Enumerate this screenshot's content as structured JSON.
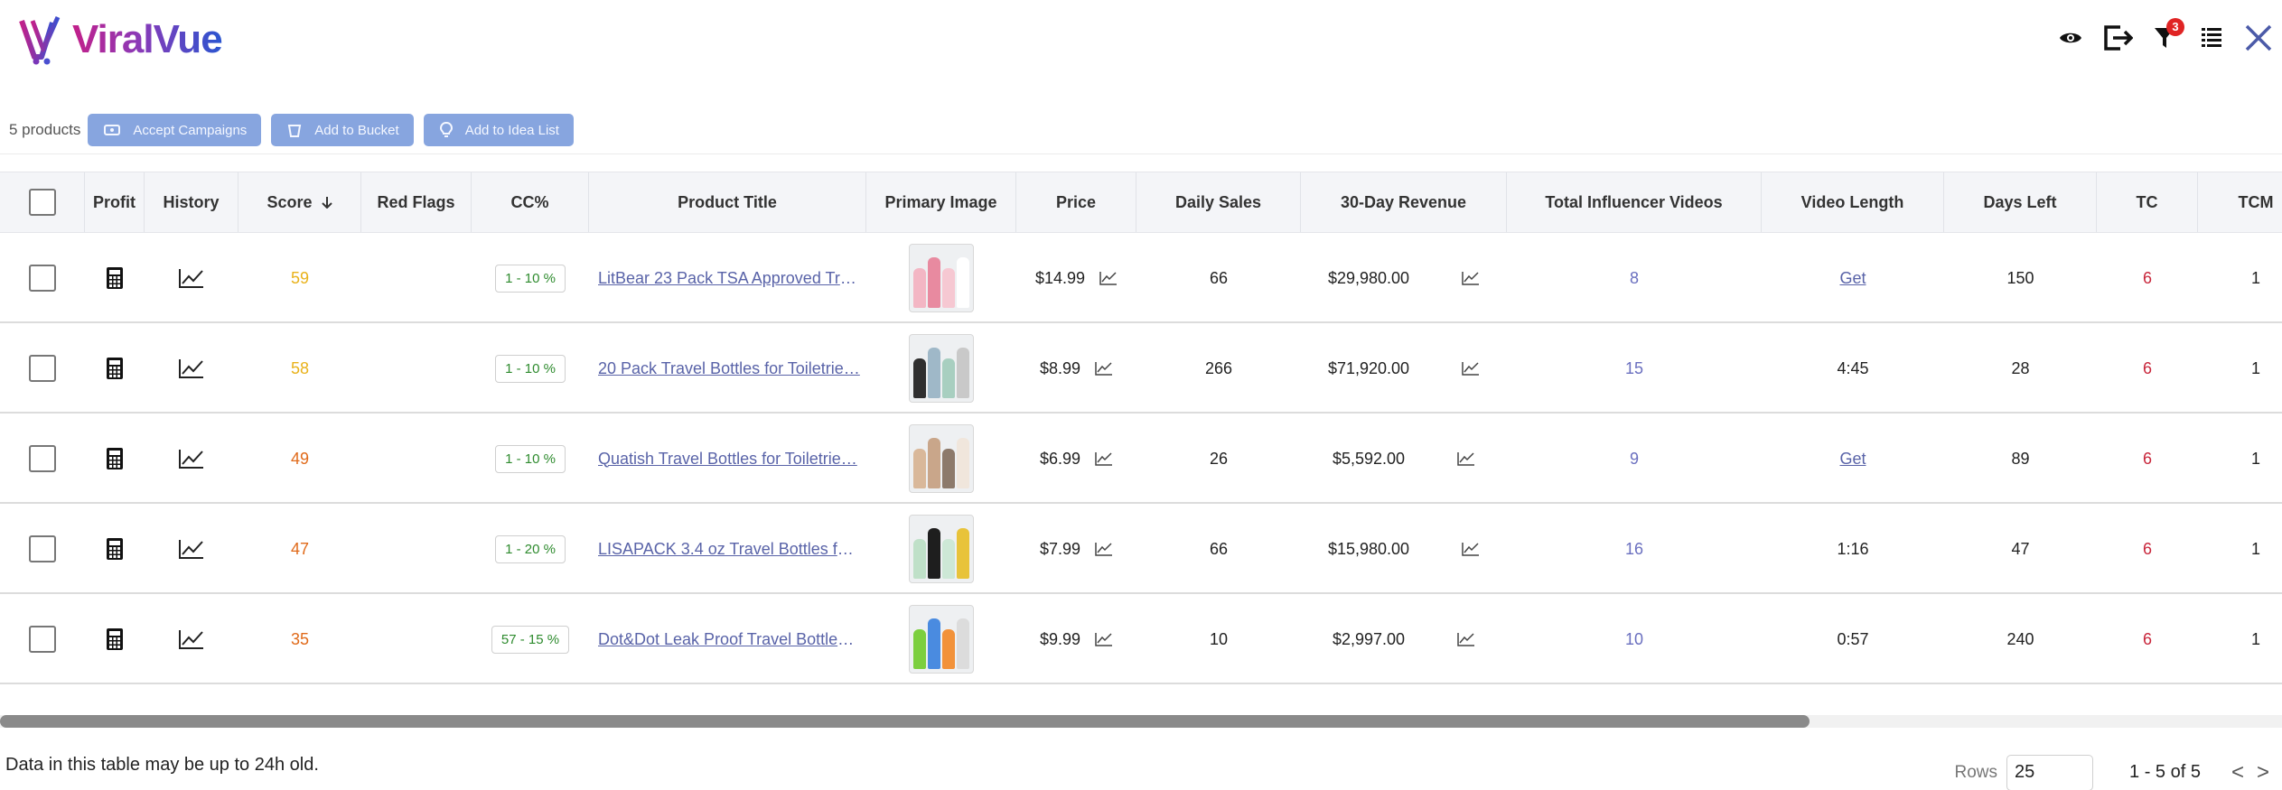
{
  "app": {
    "brand": "ViralVue"
  },
  "header": {
    "icons": [
      "eye-icon",
      "export-icon",
      "filter-icon",
      "columns-icon",
      "close-icon"
    ],
    "filter_badge": "3"
  },
  "toolbar": {
    "product_count": "5 products",
    "accept_campaigns": "Accept Campaigns",
    "add_to_bucket": "Add to Bucket",
    "add_to_idea_list": "Add to Idea List"
  },
  "table": {
    "columns": [
      "Profit",
      "History",
      "Score",
      "Red Flags",
      "CC%",
      "Product Title",
      "Primary Image",
      "Price",
      "Daily Sales",
      "30-Day Revenue",
      "Total Influencer Videos",
      "Video Length",
      "Days Left",
      "TC",
      "TCM"
    ],
    "sort_icon": "arrow-down-icon",
    "rows": [
      {
        "score": "59",
        "score_color": "#e9b21b",
        "red_flags": "",
        "cc": "1 - 10 %",
        "title": "LitBear 23 Pack TSA Approved Tra…",
        "price": "$14.99",
        "daily_sales": "66",
        "revenue": "$29,980.00",
        "videos": "8",
        "video_length": "Get",
        "days_left": "150",
        "tc": "6",
        "tcm": "1",
        "image_colors": [
          "#f3b6c4",
          "#e88aa0",
          "#f6c8d2",
          "#ffffff"
        ]
      },
      {
        "score": "58",
        "score_color": "#e9b21b",
        "red_flags": "",
        "cc": "1 - 10 %",
        "title": "20 Pack Travel Bottles for Toiletrie…",
        "price": "$8.99",
        "daily_sales": "266",
        "revenue": "$71,920.00",
        "videos": "15",
        "video_length": "4:45",
        "days_left": "28",
        "tc": "6",
        "tcm": "1",
        "image_colors": [
          "#2f2f2f",
          "#9fb8c8",
          "#a8cfc0",
          "#c9c9c9"
        ]
      },
      {
        "score": "49",
        "score_color": "#e06a1a",
        "red_flags": "",
        "cc": "1 - 10 %",
        "title": "Quatish Travel Bottles for Toiletrie…",
        "price": "$6.99",
        "daily_sales": "26",
        "revenue": "$5,592.00",
        "videos": "9",
        "video_length": "Get",
        "days_left": "89",
        "tc": "6",
        "tcm": "1",
        "image_colors": [
          "#d9b89a",
          "#c9a68a",
          "#8d7a6b",
          "#f0e6dc"
        ]
      },
      {
        "score": "47",
        "score_color": "#e06a1a",
        "red_flags": "",
        "cc": "1 - 20 %",
        "title": "LISAPACK 3.4 oz Travel Bottles for …",
        "price": "$7.99",
        "daily_sales": "66",
        "revenue": "$15,980.00",
        "videos": "16",
        "video_length": "1:16",
        "days_left": "47",
        "tc": "6",
        "tcm": "1",
        "image_colors": [
          "#bfe0c8",
          "#1e1e1e",
          "#cde8d6",
          "#e8c33a"
        ]
      },
      {
        "score": "35",
        "score_color": "#e06a1a",
        "red_flags": "",
        "cc": "57 - 15 %",
        "title": "Dot&Dot Leak Proof Travel Bottles…",
        "price": "$9.99",
        "daily_sales": "10",
        "revenue": "$2,997.00",
        "videos": "10",
        "video_length": "0:57",
        "days_left": "240",
        "tc": "6",
        "tcm": "1",
        "image_colors": [
          "#7ccf3f",
          "#4a8be0",
          "#f2923a",
          "#dcdcdc"
        ]
      }
    ]
  },
  "footer": {
    "note": "Data in this table may be up to 24h old.",
    "rows_label": "Rows",
    "rows_value": "25",
    "range": "1 - 5 of 5",
    "prev": "<",
    "next": ">"
  },
  "colors": {
    "accent": "#87a5df",
    "link": "#5963a8",
    "tc_red": "#c8263b"
  }
}
